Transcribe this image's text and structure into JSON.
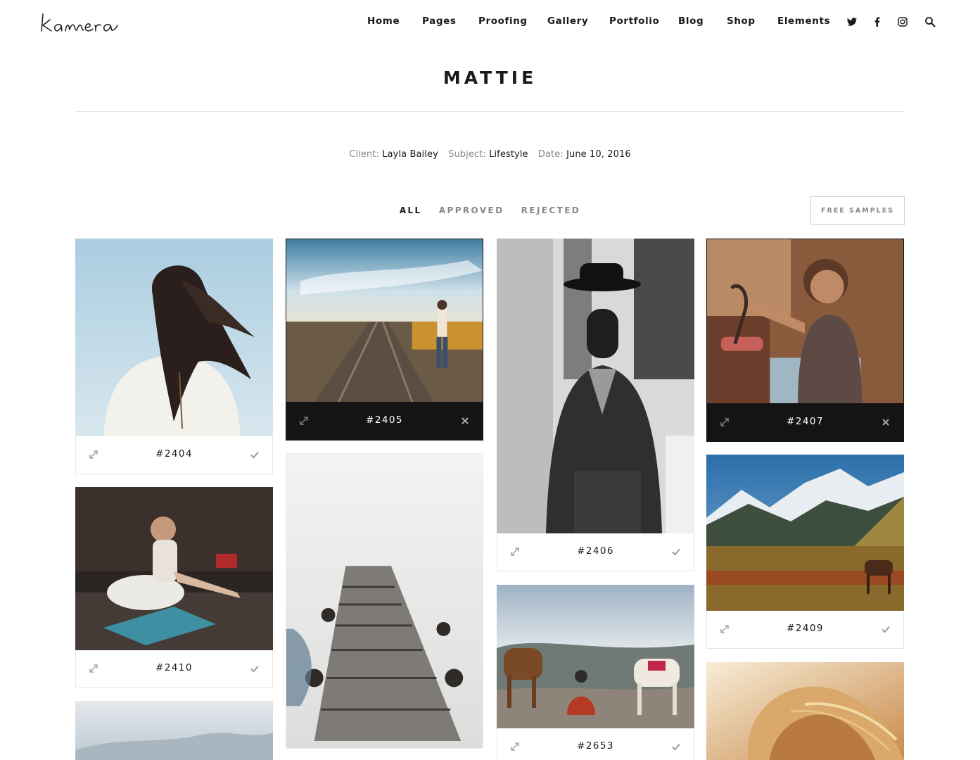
{
  "brand": {
    "logo_text": "kamera"
  },
  "nav": {
    "items": [
      "Home",
      "Pages",
      "Proofing",
      "Gallery",
      "Portfolio",
      "Blog",
      "Shop",
      "Elements"
    ],
    "icons": [
      "twitter-icon",
      "facebook-icon",
      "instagram-icon",
      "search-icon"
    ]
  },
  "page": {
    "title": "MATTIE"
  },
  "meta": {
    "client_label": "Client:",
    "client": "Layla Bailey",
    "subject_label": "Subject:",
    "subject": "Lifestyle",
    "date_label": "Date:",
    "date": "June 10, 2016"
  },
  "filters": {
    "all": "ALL",
    "approved": "APPROVED",
    "rejected": "REJECTED"
  },
  "free_samples": "FREE SAMPLES",
  "gallery": {
    "items": [
      {
        "id": "#2404",
        "status": "approved"
      },
      {
        "id": "#2405",
        "status": "rejected"
      },
      {
        "id": "#2406",
        "status": "approved"
      },
      {
        "id": "#2407",
        "status": "rejected"
      },
      {
        "id": "#2410",
        "status": "approved"
      },
      {
        "id": "#2409",
        "status": "approved"
      },
      {
        "id": "#2653",
        "status": "approved"
      }
    ]
  },
  "colors": {
    "text": "#1a1a1a",
    "muted": "#888888",
    "rejected_bar": "#141414",
    "divider": "#e6e6e6"
  }
}
